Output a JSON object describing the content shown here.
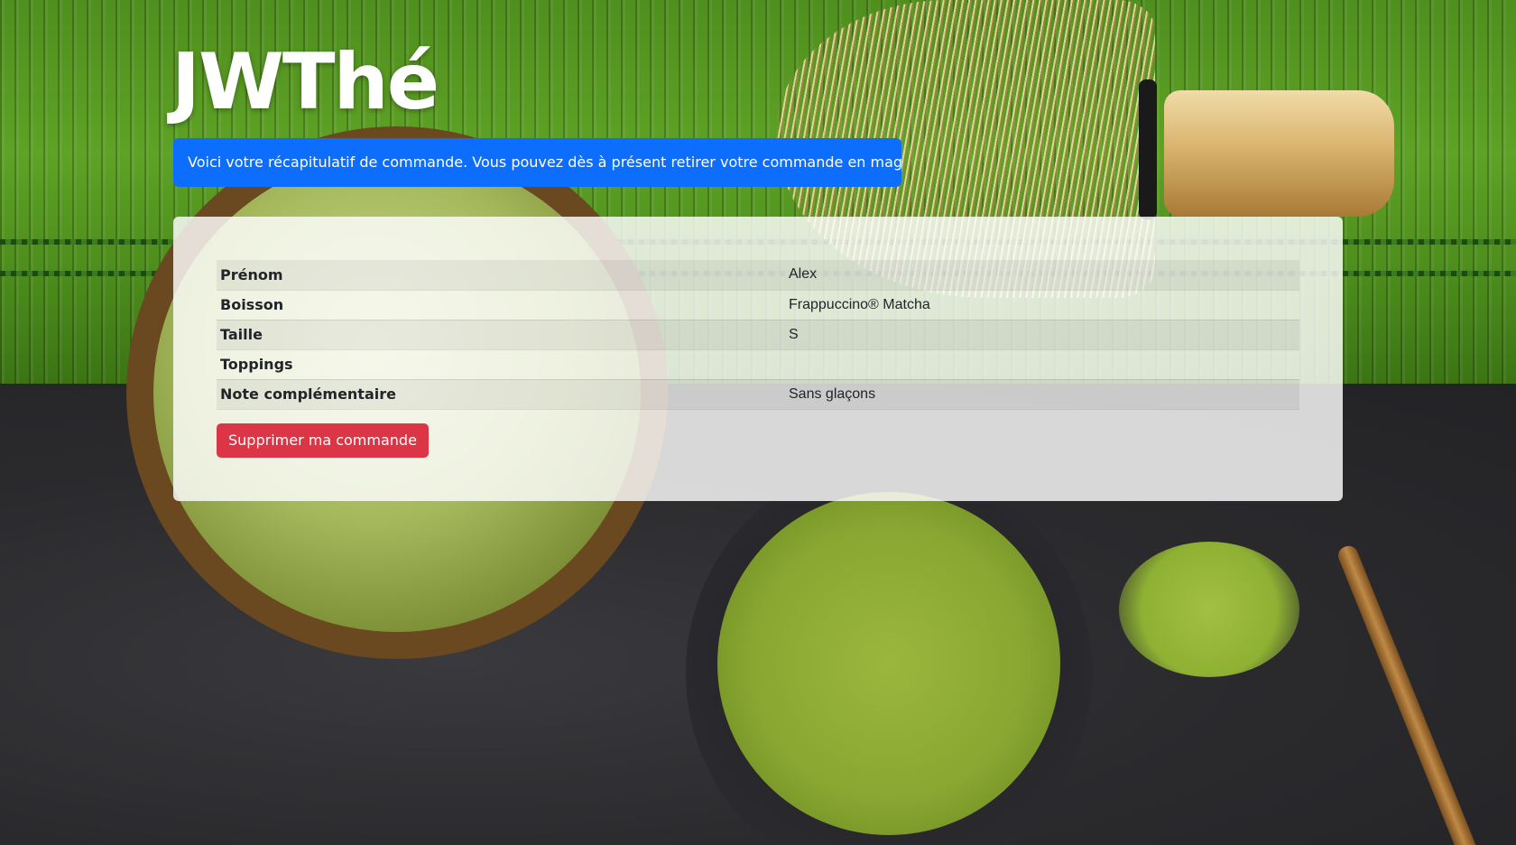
{
  "brand": {
    "title": "JWThé"
  },
  "alert": {
    "message": "Voici votre récapitulatif de commande. Vous pouvez dès à présent retirer votre commande en magasin."
  },
  "order_summary": {
    "rows": [
      {
        "label": "Prénom",
        "value": "Alex"
      },
      {
        "label": "Boisson",
        "value": "Frappuccino® Matcha"
      },
      {
        "label": "Taille",
        "value": "S"
      },
      {
        "label": "Toppings",
        "value": ""
      },
      {
        "label": "Note complémentaire",
        "value": "Sans glaçons"
      }
    ]
  },
  "actions": {
    "delete_label": "Supprimer ma commande"
  },
  "colors": {
    "alert_bg": "#0d6efd",
    "delete_bg": "#dc3545",
    "card_bg": "rgba(255,255,255,0.82)"
  }
}
